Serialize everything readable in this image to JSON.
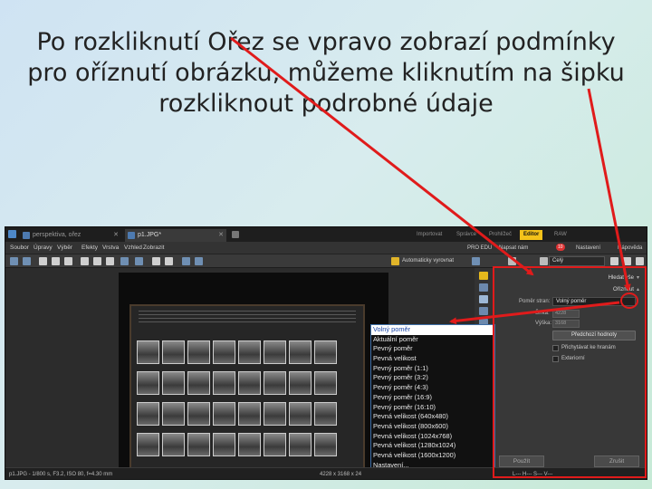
{
  "slide": {
    "title_lines": [
      "Po rozkliknutí  Ořez se vpravo zobrazí podmínky",
      "pro oříznutí obrázku, můžeme kliknutím na šipku",
      "rozkliknout podrobné údaje"
    ]
  },
  "app": {
    "tabs": [
      {
        "label": "perspektiva, ořez"
      },
      {
        "label": "p1.JPG*"
      }
    ],
    "modes": [
      "Importovat",
      "Správce",
      "Prohlížeč",
      "Editor",
      "RAW"
    ],
    "active_mode": "Editor",
    "menu": [
      "Soubor",
      "Úpravy",
      "Výběr",
      "Efekty",
      "Vrstva",
      "Vzhled",
      "Zobrazit"
    ],
    "menu_right": {
      "pro_edu": "PRO EDU",
      "napsat": "Napsat nám",
      "badge": "10",
      "settings": "Nastavení",
      "help": "Nápověda"
    },
    "toolbar": {
      "auto_label": "Automaticky vyrovnat",
      "zoom_value": "Celý"
    },
    "panel": {
      "head_expand": "Hledat vše",
      "head_crop": "Oříznout",
      "ratio_label": "Poměr stran:",
      "ratio_value": "Volný poměr",
      "width_label": "Šířka:",
      "width_value": "4228",
      "height_label": "Výška:",
      "height_value": "3168",
      "prev_button": "Předchozí hodnoty",
      "check_snap": "Přichytávat ke hranám",
      "check_outside": "Exteriorní",
      "apply_button": "Použít",
      "cancel_button": "Zrušit"
    },
    "dropdown_items": [
      "Volný poměr",
      "Aktuální poměr",
      "Pevný poměr",
      "Pevná velikost",
      "Pevný poměr (1:1)",
      "Pevný poměr (3:2)",
      "Pevný poměr (4:3)",
      "Pevný poměr (16:9)",
      "Pevný poměr (16:10)",
      "Pevná velikost (640x480)",
      "Pevná velikost (800x600)",
      "Pevná velikost (1024x768)",
      "Pevná velikost (1280x1024)",
      "Pevná velikost (1600x1200)",
      "Nastavení..."
    ],
    "status": {
      "left": "p1.JPG - 1/800 s, F3.2, ISO 80, f=4.30 mm",
      "center": "4228 x 3168 x 24",
      "right": "L--- H--- S--- V---"
    }
  },
  "colors": {
    "annotation_red": "#e01b1b",
    "editor_tab": "#f4c21a",
    "dropdown_selected_text": "#1a46a8"
  }
}
